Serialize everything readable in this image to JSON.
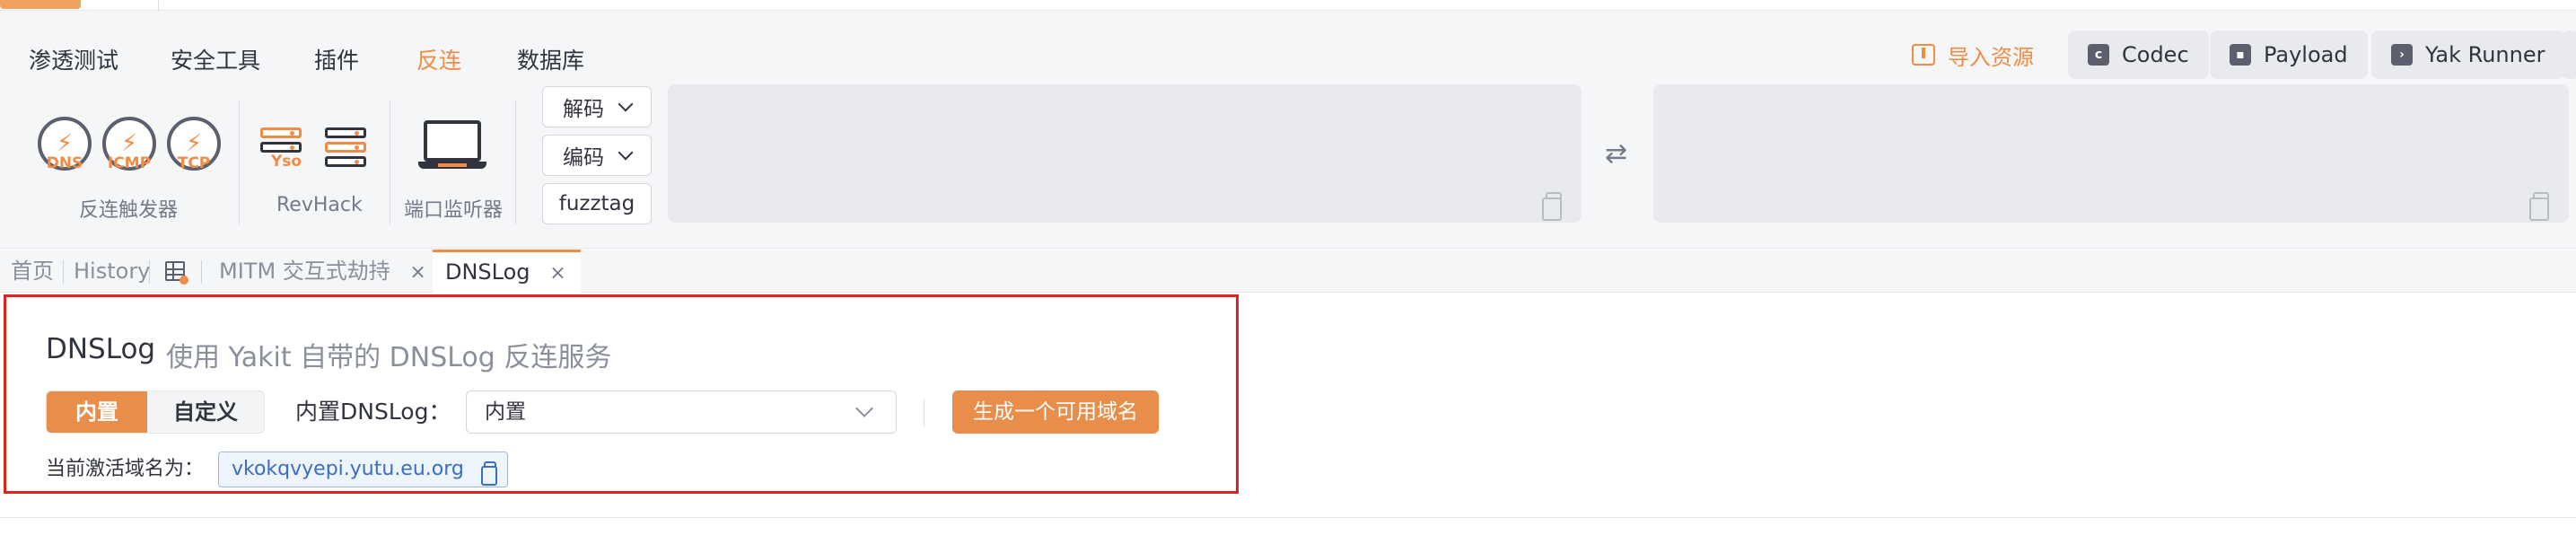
{
  "menu": {
    "items": [
      "渗透测试",
      "安全工具",
      "插件",
      "反连",
      "数据库"
    ],
    "active_index": 3
  },
  "top_actions": {
    "import_label": "导入资源",
    "codec_label": "Codec",
    "payload_label": "Payload",
    "yak_runner_label": "Yak Runner"
  },
  "tool_groups": {
    "reverse_trigger": {
      "label": "反连触发器",
      "items": [
        "DNS",
        "ICMP",
        "TCP"
      ]
    },
    "revhack": {
      "label": "RevHack",
      "yso_badge": "Yso"
    },
    "port_listener": {
      "label": "端口监听器"
    }
  },
  "codec": {
    "decode_label": "解码",
    "encode_label": "编码",
    "fuzztag_label": "fuzztag"
  },
  "tabs": [
    {
      "label": "首页"
    },
    {
      "label": "History"
    },
    {
      "label": "MITM 交互式劫持",
      "closable": true
    },
    {
      "label": "DNSLog",
      "closable": true,
      "active": true
    }
  ],
  "dnslog": {
    "title": "DNSLog",
    "subtitle": "使用 Yakit 自带的 DNSLog 反连服务",
    "mode_builtin": "内置",
    "mode_custom": "自定义",
    "builtin_dns_label": "内置DNSLog：",
    "builtin_dns_value": "内置",
    "generate_button": "生成一个可用域名",
    "current_domain_label": "当前激活域名为：",
    "current_domain_value": "vkokqvyepi.yutu.eu.org"
  },
  "colors": {
    "accent": "#f28b44",
    "highlight_border": "#e0221f",
    "link": "#3b6ec2"
  }
}
